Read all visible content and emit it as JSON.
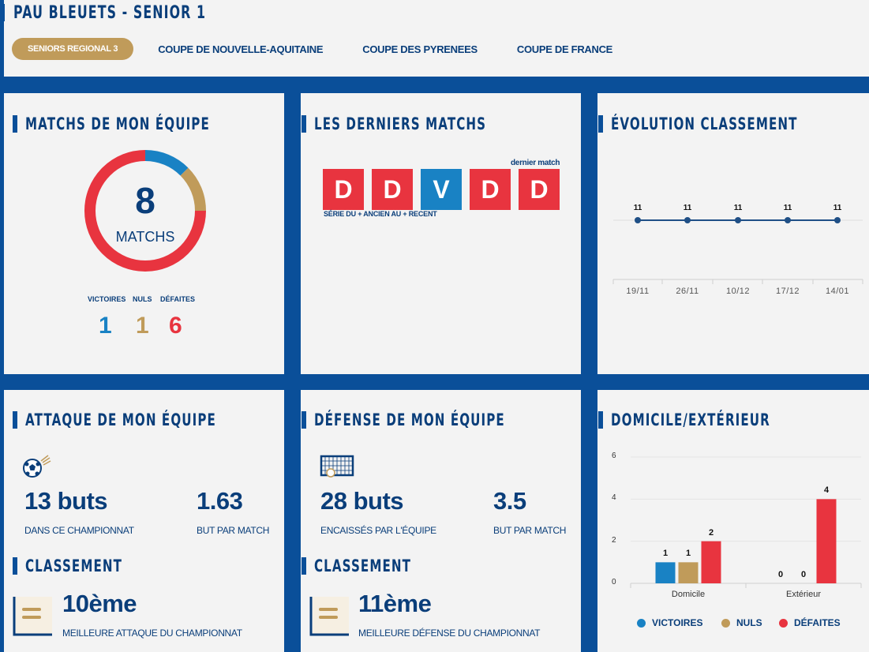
{
  "header": {
    "title": "PAU BLEUETS - SENIOR 1",
    "tabs": [
      {
        "label": "SENIORS REGIONAL 3",
        "active": true
      },
      {
        "label": "COUPE DE NOUVELLE-AQUITAINE",
        "active": false
      },
      {
        "label": "COUPE DES PYRENEES",
        "active": false
      },
      {
        "label": "COUPE DE FRANCE",
        "active": false
      }
    ]
  },
  "colors": {
    "blue": "#0a4f99",
    "navy": "#0a3e7a",
    "victory": "#1982c4",
    "draw": "#c09b5a",
    "defeat": "#e8343f"
  },
  "matchs": {
    "title": "MATCHS DE MON ÉQUIPE",
    "total": "8",
    "total_label": "MATCHS",
    "labels": {
      "victoires": "VICTOIRES",
      "nuls": "NULS",
      "defaites": "DÉFAITES"
    },
    "victoires": "1",
    "nuls": "1",
    "defaites": "6"
  },
  "derniers": {
    "title": "LES DERNIERS MATCHS",
    "last_label": "dernier match",
    "order_label": "SÉRIE DU + ANCIEN AU + RECENT",
    "results": [
      "D",
      "D",
      "V",
      "D",
      "D"
    ]
  },
  "evolution": {
    "title": "ÉVOLUTION CLASSEMENT",
    "dates": [
      "19/11",
      "26/11",
      "10/12",
      "17/12",
      "14/01"
    ],
    "ranks": [
      "11",
      "11",
      "11",
      "11",
      "11"
    ]
  },
  "attaque": {
    "title": "ATTAQUE DE MON ÉQUIPE",
    "icon": "soccer-ball-icon",
    "buts": "13 buts",
    "buts_label": "DANS CE CHAMPIONNAT",
    "ratio": "1.63",
    "ratio_label": "BUT PAR MATCH",
    "classement_title": "CLASSEMENT",
    "rank": "10ème",
    "rank_label": "MEILLEURE ATTAQUE DU CHAMPIONNAT"
  },
  "defense": {
    "title": "DÉFENSE DE MON ÉQUIPE",
    "icon": "goal-net-icon",
    "buts": "28 buts",
    "buts_label": "ENCAISSÉS PAR L'ÉQUIPE",
    "ratio": "3.5",
    "ratio_label": "BUT PAR MATCH",
    "classement_title": "CLASSEMENT",
    "rank": "11ème",
    "rank_label": "MEILLEURE DÉFENSE DU CHAMPIONNAT"
  },
  "domicile": {
    "title": "DOMICILE/EXTÉRIEUR",
    "legend": [
      "VICTOIRES",
      "NULS",
      "DÉFAITES"
    ]
  },
  "chart_data": {
    "type": "bar",
    "categories": [
      "Domicile",
      "Extérieur"
    ],
    "series": [
      {
        "name": "VICTOIRES",
        "values": [
          1,
          0
        ]
      },
      {
        "name": "NULS",
        "values": [
          1,
          0
        ]
      },
      {
        "name": "DÉFAITES",
        "values": [
          2,
          4
        ]
      }
    ],
    "ylim": [
      0,
      6
    ],
    "yticks": [
      0,
      2,
      4,
      6
    ],
    "legend_position": "bottom",
    "grid": true
  }
}
